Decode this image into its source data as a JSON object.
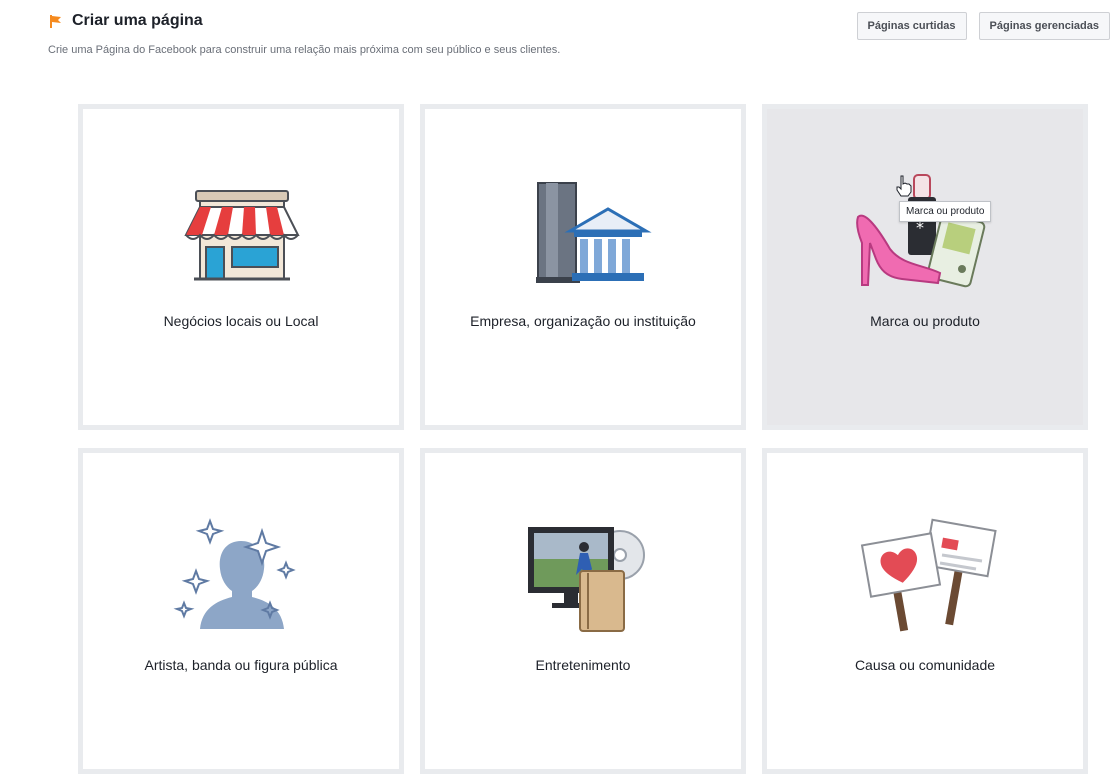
{
  "header": {
    "title": "Criar uma página",
    "subtitle": "Crie uma Página do Facebook para construir uma relação mais próxima com seu público e seus clientes.",
    "icon": "flag-icon"
  },
  "top_buttons": {
    "liked": "Páginas curtidas",
    "managed": "Páginas gerenciadas"
  },
  "tiles": [
    {
      "label": "Negócios locais ou Local",
      "icon": "storefront-icon"
    },
    {
      "label": "Empresa, organização ou instituição",
      "icon": "buildings-icon"
    },
    {
      "label": "Marca ou produto",
      "icon": "products-icon",
      "tooltip": "Marca ou produto"
    },
    {
      "label": "Artista, banda ou figura pública",
      "icon": "person-stars-icon"
    },
    {
      "label": "Entretenimento",
      "icon": "tv-media-icon"
    },
    {
      "label": "Causa ou comunidade",
      "icon": "protest-signs-icon"
    }
  ],
  "colors": {
    "accent_orange": "#f58a1f",
    "tile_border": "#e9ebee",
    "hover_bg": "#e7e7ea"
  }
}
